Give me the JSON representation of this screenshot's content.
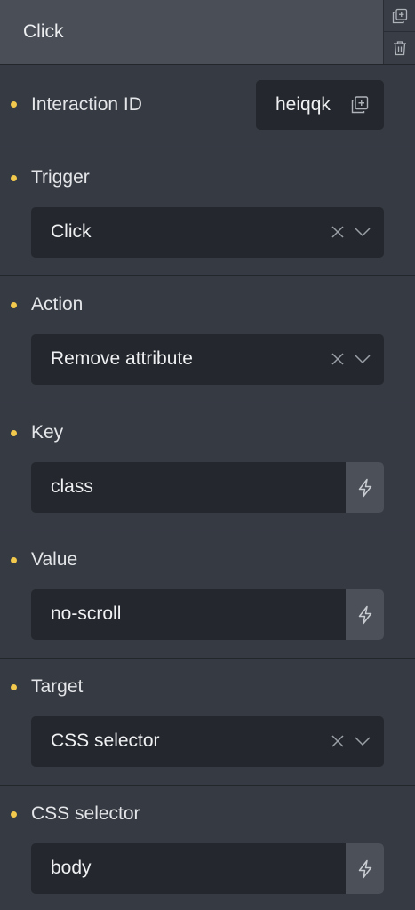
{
  "header": {
    "title": "Click",
    "duplicate_icon": "duplicate-icon",
    "delete_icon": "trash-icon"
  },
  "interaction_id": {
    "label": "Interaction ID",
    "value": "heiqqk",
    "copy_icon": "copy-icon"
  },
  "trigger": {
    "label": "Trigger",
    "value": "Click"
  },
  "action": {
    "label": "Action",
    "value": "Remove attribute"
  },
  "key": {
    "label": "Key",
    "value": "class"
  },
  "value_field": {
    "label": "Value",
    "value": "no-scroll"
  },
  "target": {
    "label": "Target",
    "value": "CSS selector"
  },
  "css_selector": {
    "label": "CSS selector",
    "value": "body"
  },
  "colors": {
    "accent_dot": "#f2c94c",
    "panel_bg": "#363a42",
    "field_bg": "#24272d"
  }
}
